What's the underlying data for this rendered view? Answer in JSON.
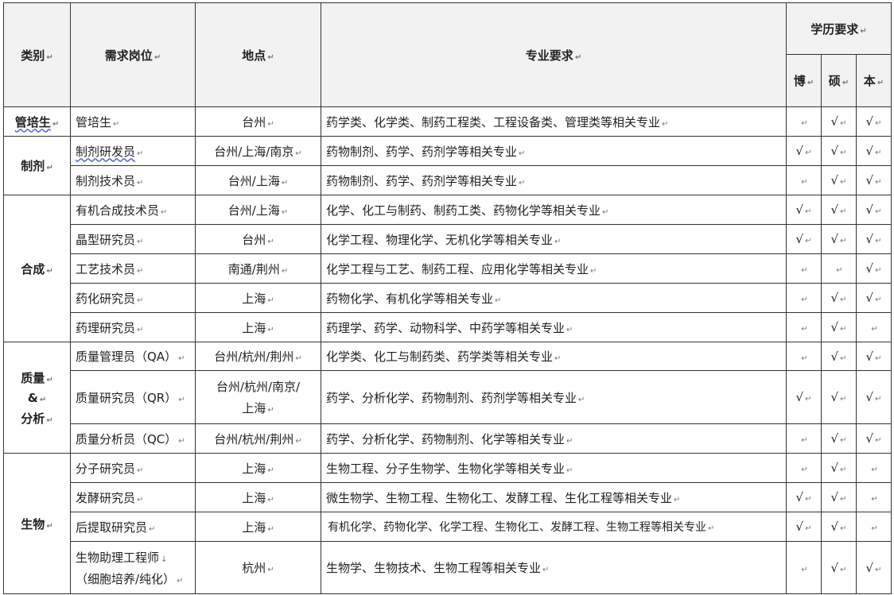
{
  "header": {
    "category": "类别",
    "position": "需求岗位",
    "location": "地点",
    "major": "专业要求",
    "education": "学历要求",
    "phd": "博",
    "master": "硕",
    "bachelor": "本"
  },
  "paragraph_mark": "↵",
  "categories": {
    "trainee": "管培生",
    "preparation": "制剂",
    "synthesis": "合成",
    "quality_line1": "质量",
    "quality_line2": "&",
    "quality_line3": "分析",
    "biology": "生物"
  },
  "rows": [
    {
      "position": "管培生",
      "location": "台州",
      "major": "药学类、化学类、制药工程类、工程设备类、管理类等相关专业",
      "phd": "",
      "master": "√",
      "bachelor": "√"
    },
    {
      "position": "制剂研发员",
      "location": "台州/上海/南京",
      "major": "药物制剂、药学、药剂学等相关专业",
      "phd": "√",
      "master": "√",
      "bachelor": "√"
    },
    {
      "position": "制剂技术员",
      "location": "台州/上海",
      "major": "药物制剂、药学、药剂学等相关专业",
      "phd": "",
      "master": "√",
      "bachelor": "√"
    },
    {
      "position": "有机合成技术员",
      "location": "台州/上海",
      "major": "化学、化工与制药、制药工类、药物化学等相关专业",
      "phd": "√",
      "master": "√",
      "bachelor": "√"
    },
    {
      "position": "晶型研究员",
      "location": "台州",
      "major": "化学工程、物理化学、无机化学等相关专业",
      "phd": "√",
      "master": "√",
      "bachelor": "√"
    },
    {
      "position": "工艺技术员",
      "location": "南通/荆州",
      "major": "化学工程与工艺、制药工程、应用化学等相关专业",
      "phd": "",
      "master": "",
      "bachelor": "√"
    },
    {
      "position": "药化研究员",
      "location": "上海",
      "major": "药物化学、有机化学等相关专业",
      "phd": "",
      "master": "√",
      "bachelor": "√"
    },
    {
      "position": "药理研究员",
      "location": "上海",
      "major": "药理学、药学、动物科学、中药学等相关专业",
      "phd": "",
      "master": "√",
      "bachelor": ""
    },
    {
      "position": "质量管理员（QA）",
      "location": "台州/杭州/荆州",
      "major": "化学类、化工与制药类、药学类等相关专业",
      "phd": "",
      "master": "√",
      "bachelor": "√"
    },
    {
      "position": "质量研究员（QR）",
      "location_line1": "台州/杭州/南京/",
      "location_line2": "上海",
      "major": "药学、分析化学、药物制剂、药剂学等相关专业",
      "phd": "√",
      "master": "√",
      "bachelor": "√"
    },
    {
      "position": "质量分析员（QC）",
      "location": "台州/杭州/荆州",
      "major": "药学、分析化学、药物制剂、化学等相关专业",
      "phd": "",
      "master": "√",
      "bachelor": "√"
    },
    {
      "position": "分子研究员",
      "location": "上海",
      "major": "生物工程、分子生物学、生物化学等相关专业",
      "phd": "",
      "master": "√",
      "bachelor": ""
    },
    {
      "position": "发酵研究员",
      "location": "上海",
      "major": "微生物学、生物工程、生物化工、发酵工程、生化工程等相关专业",
      "phd": "√",
      "master": "√",
      "bachelor": ""
    },
    {
      "position": "后提取研究员",
      "location": "上海",
      "major": "有机化学、药物化学、化学工程、生物化工、发酵工程、生物工程等相关专业",
      "phd": "√",
      "master": "√",
      "bachelor": ""
    },
    {
      "position_line1": "生物助理工程师",
      "position_line2": "（细胞培养/纯化）",
      "location": "杭州",
      "major": "生物学、生物技术、生物工程等相关专业",
      "phd": "",
      "master": "√",
      "bachelor": "√"
    }
  ]
}
